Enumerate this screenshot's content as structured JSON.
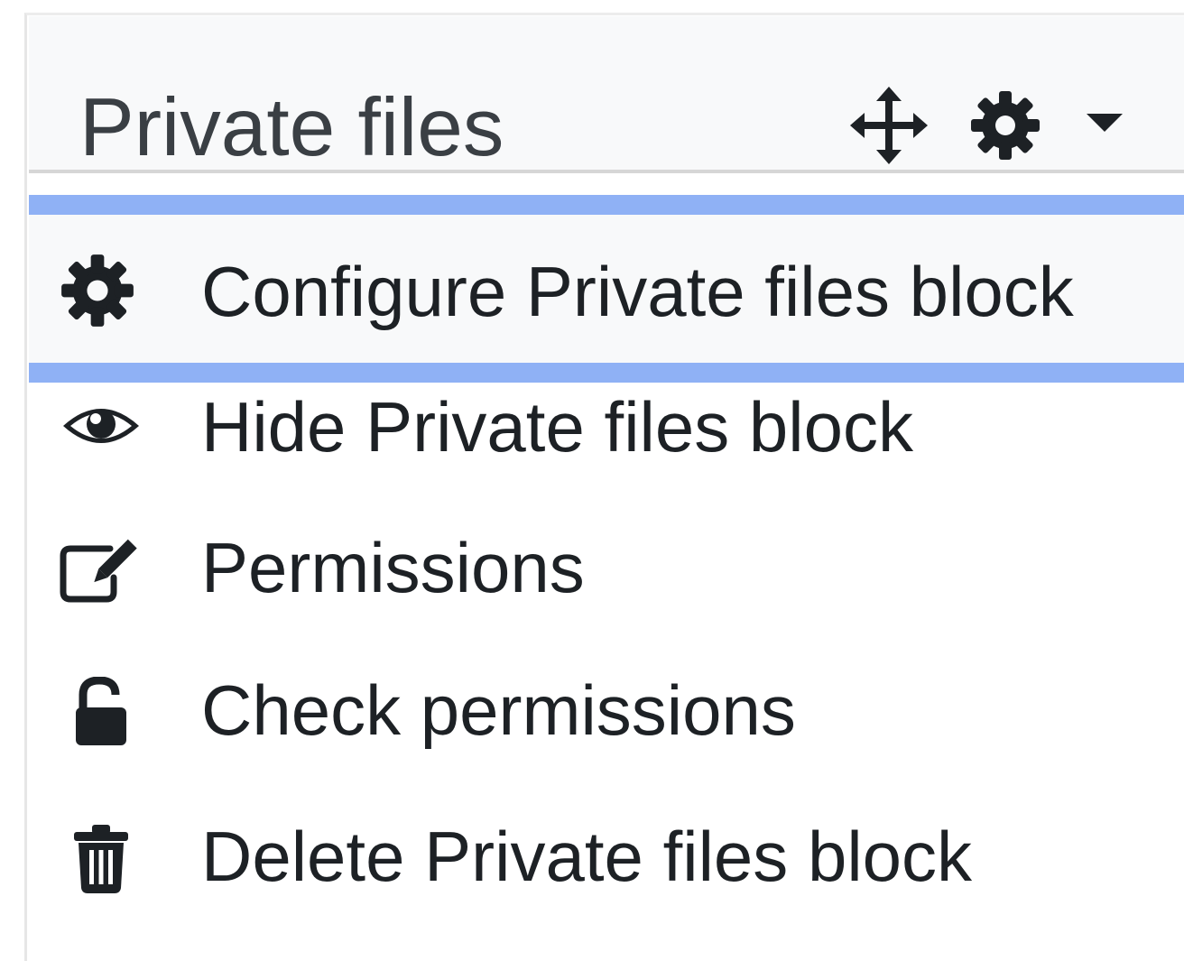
{
  "block": {
    "title": "Private files",
    "header_icons": [
      "move-icon",
      "gear-icon",
      "caret-down-icon"
    ]
  },
  "menu": {
    "items": [
      {
        "label": "Configure Private files block",
        "icon": "gear-icon",
        "focused": true
      },
      {
        "label": "Hide Private files block",
        "icon": "eye-icon",
        "focused": false
      },
      {
        "label": "Permissions",
        "icon": "edit-icon",
        "focused": false
      },
      {
        "label": "Check permissions",
        "icon": "unlock-icon",
        "focused": false
      },
      {
        "label": "Delete Private files block",
        "icon": "trash-icon",
        "focused": false
      }
    ]
  },
  "colors": {
    "focus_ring": "#8fb1f5",
    "header_bg": "#f8f9fa",
    "text": "#1d2125",
    "icon": "#1d2125"
  }
}
